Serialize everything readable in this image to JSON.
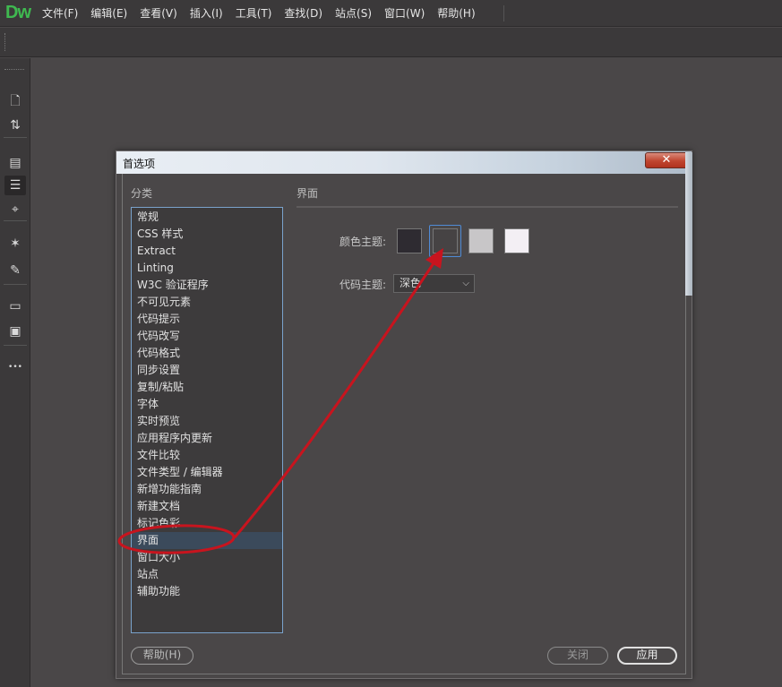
{
  "app": {
    "logo": "Dw"
  },
  "menu": [
    "文件(F)",
    "编辑(E)",
    "查看(V)",
    "插入(I)",
    "工具(T)",
    "查找(D)",
    "站点(S)",
    "窗口(W)",
    "帮助(H)"
  ],
  "tools": [
    {
      "name": "new-document-icon",
      "glyph": "🗋"
    },
    {
      "name": "transfer-icon",
      "glyph": "⇅"
    },
    {
      "name": "inspect-icon",
      "glyph": "▤"
    },
    {
      "name": "format-lines-icon",
      "glyph": "☰"
    },
    {
      "name": "target-icon",
      "glyph": "⌖"
    },
    {
      "name": "wand-icon",
      "glyph": "✶"
    },
    {
      "name": "brush-icon",
      "glyph": "✎"
    },
    {
      "name": "comment-icon",
      "glyph": "▭"
    },
    {
      "name": "snippet-icon",
      "glyph": "▣"
    },
    {
      "name": "more-icon",
      "glyph": "•••"
    }
  ],
  "dialog": {
    "title": "首选项",
    "close_glyph": "✕",
    "category_heading": "分类",
    "categories": [
      "常规",
      "CSS 样式",
      "Extract",
      "Linting",
      "W3C 验证程序",
      "不可见元素",
      "代码提示",
      "代码改写",
      "代码格式",
      "同步设置",
      "复制/粘贴",
      "字体",
      "实时预览",
      "应用程序内更新",
      "文件比较",
      "文件类型 / 编辑器",
      "新增功能指南",
      "新建文档",
      "标记色彩",
      "界面",
      "窗口大小",
      "站点",
      "辅助功能"
    ],
    "selected_category": "界面",
    "panel_heading": "界面",
    "color_theme_label": "颜色主题:",
    "color_themes": [
      {
        "color": "#2e2b31"
      },
      {
        "color": "#464344",
        "selected": true
      },
      {
        "color": "#c8c6c8"
      },
      {
        "color": "#f3eff4"
      }
    ],
    "code_theme_label": "代码主题:",
    "code_theme_value": "深色",
    "buttons": {
      "help": "帮助(H)",
      "close": "关闭",
      "apply": "应用"
    }
  },
  "colors": {
    "annotation": "#c8141e",
    "selection_border": "#4f8bd6"
  }
}
